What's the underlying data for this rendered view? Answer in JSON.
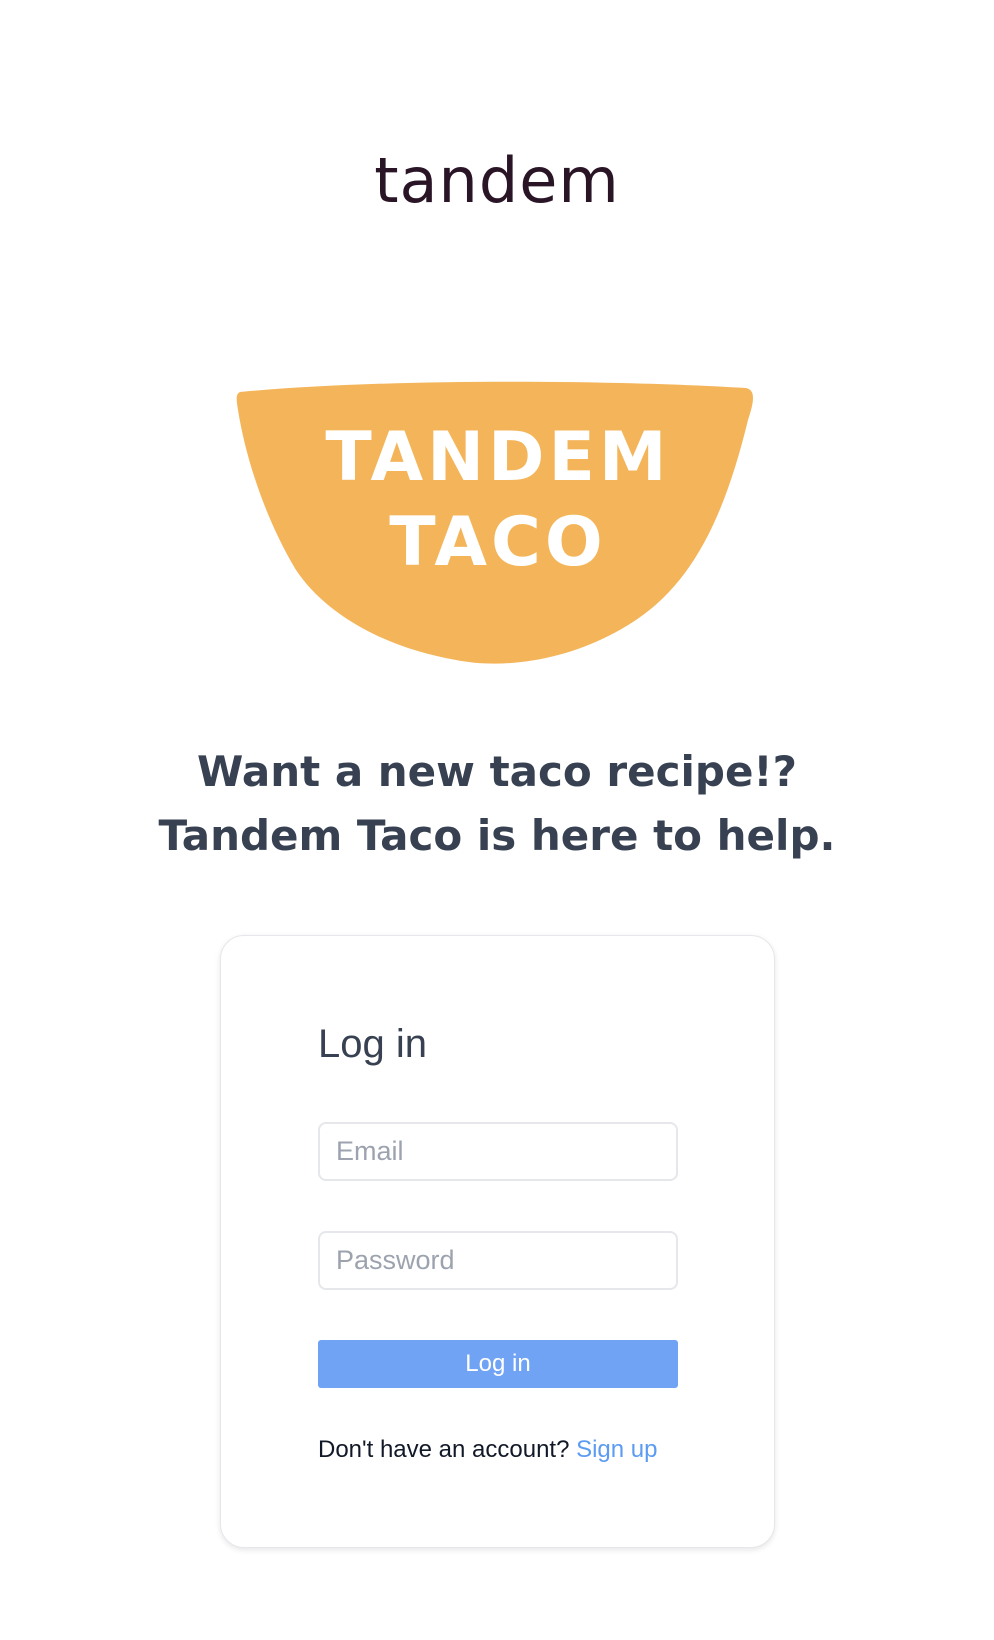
{
  "header": {
    "brand_logo_text": "tandem"
  },
  "hero": {
    "logo_line1": "TANDEM",
    "logo_line2": "TACO",
    "logo_color": "#f4b55a",
    "tagline_line1": "Want a new taco recipe!?",
    "tagline_line2": "Tandem Taco is here to help."
  },
  "login": {
    "title": "Log in",
    "email_placeholder": "Email",
    "email_value": "",
    "password_placeholder": "Password",
    "password_value": "",
    "submit_label": "Log in",
    "signup_prompt": "Don't have an account?",
    "signup_link": "Sign up"
  },
  "colors": {
    "button": "#70a3f3",
    "link": "#5b9cf2",
    "heading": "#374151",
    "brand": "#2a1526"
  }
}
